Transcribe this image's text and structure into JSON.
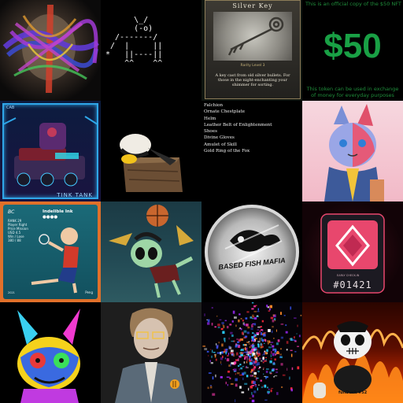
{
  "gallery": {
    "ascii_art": "      \\_/\n      (-o)\n  /-------/\n /  |     ||\n*   ||----||\n    ^^    ^^",
    "silver_key": {
      "title": "Silver Key",
      "subtitle": "Rarity Level 3",
      "description": "A key cast from old silver bullets. For those in the night-enchanting your shimmer for sorting."
    },
    "fifty_token": {
      "top_text": "This is an official copy of the $50 NFT",
      "amount": "$50",
      "bottom_text": "This token can be used in exchange of money for everyday purposes"
    },
    "tank_card": {
      "name": "TINK TANK",
      "badge": "CAB"
    },
    "item_list": [
      "Falchion",
      "Ornate Chestplate",
      "Helm",
      "Leather Belt of Enlightenment",
      "Shoes",
      "Divine Gloves",
      "Amulet of Skill",
      "Gold Ring of the Fox"
    ],
    "badminton_card": {
      "logo": "BC",
      "brand": "Indelible Ink",
      "stars": "●●●●",
      "stats": [
        "RANK 29",
        "Player Right",
        "Price Mission",
        "USD 4.5",
        "Win / Lose",
        "380 / 88"
      ],
      "footer_left": "2021",
      "footer_right": "Peng"
    },
    "fish_watch": {
      "text": "BASED FISH MAFIA"
    },
    "badge_card": {
      "number": "#01421",
      "small_text": "EARLY CHECK-IN"
    },
    "fire_toy": {
      "label": "funDuck #52"
    },
    "colors": {
      "fifty_green": "#19a045",
      "tank_frame": "#2fa6e8",
      "badminton_border": "#e0702a",
      "badge_pink": "#e8476d"
    },
    "icons": [
      "bitcoin-icon",
      "basketball-icon",
      "skull-icon",
      "crown-icon"
    ]
  }
}
